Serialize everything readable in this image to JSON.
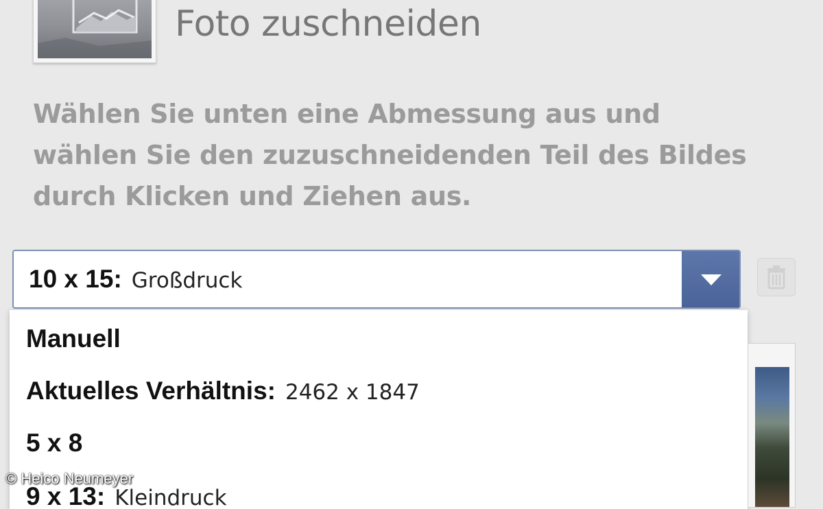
{
  "panel": {
    "title": "Foto zuschneiden",
    "instructions": "Wählen Sie unten eine Abmessung aus und wählen Sie den zuzuschneidenden Teil des Bildes durch Klicken und Ziehen aus."
  },
  "size_select": {
    "selected": {
      "size": "10 x 15",
      "separator": ":",
      "description": "Großdruck"
    },
    "options": [
      {
        "size": "Manuell",
        "separator": "",
        "description": ""
      },
      {
        "size": "Aktuelles Verhältnis",
        "separator": ":",
        "description": "2462 x 1847"
      },
      {
        "size": "5 x 8",
        "separator": "",
        "description": ""
      },
      {
        "size": "9 x 13",
        "separator": ":",
        "description": "Kleindruck"
      }
    ]
  },
  "credit": "© Heico Neumeyer",
  "icons": {
    "photo_thumbnail": "landscape-thumbnail",
    "dropdown_arrow": "chevron-down-icon",
    "trash": "trash-icon"
  },
  "colors": {
    "background": "#e9e9e9",
    "title_text": "#777777",
    "instruction_text": "#9b9b9b",
    "select_border": "#7c8fb3",
    "select_arrow_bg": "#5d77ab",
    "list_bg": "#ffffff"
  }
}
